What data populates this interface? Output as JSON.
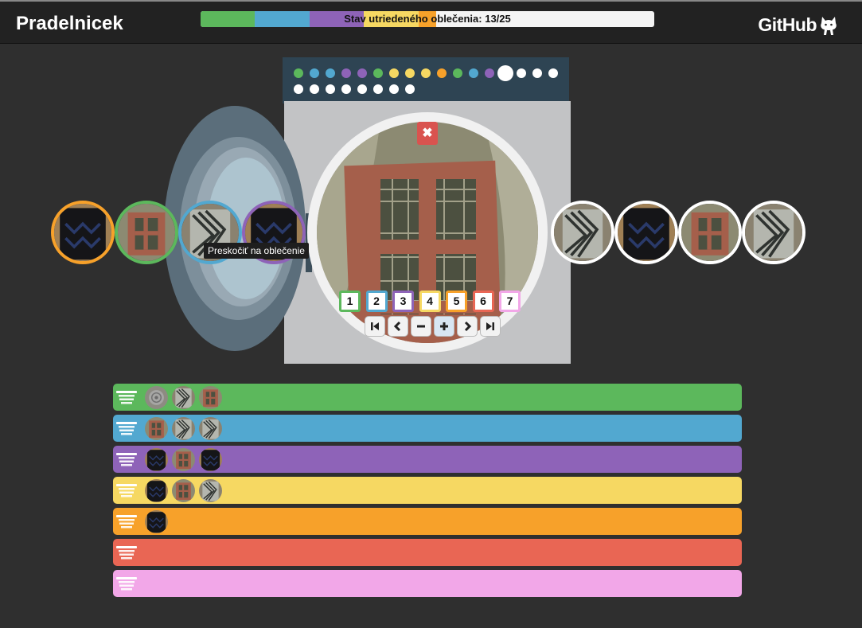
{
  "header": {
    "title": "Pradelnicek",
    "github_label": "GitHub",
    "progress_text": "Stav utriedeného oblečenia: 13/25",
    "progress_segments": [
      {
        "color": "#5cb85c",
        "fraction": 0.12
      },
      {
        "color": "#52a8d0",
        "fraction": 0.12
      },
      {
        "color": "#8e63b8",
        "fraction": 0.12
      },
      {
        "color": "#f6d862",
        "fraction": 0.12
      },
      {
        "color": "#f7a12a",
        "fraction": 0.04
      }
    ]
  },
  "dots": {
    "colors": [
      "#5cb85c",
      "#52a8d0",
      "#52a8d0",
      "#8e63b8",
      "#8e63b8",
      "#5cb85c",
      "#f6d862",
      "#f6d862",
      "#f6d862",
      "#f7a12a",
      "#5cb85c",
      "#52a8d0",
      "#8e63b8",
      "#ffffff",
      "#ffffff",
      "#ffffff",
      "#ffffff",
      "#ffffff",
      "#ffffff",
      "#ffffff",
      "#ffffff",
      "#ffffff",
      "#ffffff",
      "#ffffff",
      "#ffffff"
    ],
    "current_index": 13
  },
  "main": {
    "close_icon": "close-icon",
    "number_buttons": [
      {
        "label": "1",
        "color": "#5cb85c"
      },
      {
        "label": "2",
        "color": "#52a8d0"
      },
      {
        "label": "3",
        "color": "#8e63b8"
      },
      {
        "label": "4",
        "color": "#f6d862"
      },
      {
        "label": "5",
        "color": "#f7a12a"
      },
      {
        "label": "6",
        "color": "#e96654"
      },
      {
        "label": "7",
        "color": "#f2a7e8"
      }
    ],
    "controls": [
      "first-icon",
      "prev-icon",
      "minus-icon",
      "plus-icon",
      "next-icon",
      "last-icon"
    ]
  },
  "carousel": {
    "left": [
      {
        "border": "#f7a12a",
        "item": "dark-sweater"
      },
      {
        "border": "#5cb85c",
        "item": "pillow"
      },
      {
        "border": "#52a8d0",
        "item": "striped-shirt"
      },
      {
        "border": "#8e63b8",
        "item": "dark-sweater"
      }
    ],
    "right": [
      {
        "border": "#ffffff",
        "item": "striped-shirt"
      },
      {
        "border": "#ffffff",
        "item": "dark-sweater"
      },
      {
        "border": "#ffffff",
        "item": "pillow"
      },
      {
        "border": "#ffffff",
        "item": "striped-shirt"
      }
    ],
    "tooltip": "Preskočiť na oblečenie"
  },
  "baskets": [
    {
      "color": "#5cb85c",
      "items": [
        "grey-roll",
        "striped-shirt",
        "pillow"
      ]
    },
    {
      "color": "#52a8d0",
      "items": [
        "pillow",
        "striped-shirt",
        "striped-shirt"
      ]
    },
    {
      "color": "#8e63b8",
      "items": [
        "dark-sweater",
        "pillow",
        "dark-sweater"
      ]
    },
    {
      "color": "#f6d862",
      "items": [
        "dark-sweater",
        "pillow",
        "striped-shirt"
      ]
    },
    {
      "color": "#f7a12a",
      "items": [
        "dark-sweater"
      ]
    },
    {
      "color": "#e96654",
      "items": []
    },
    {
      "color": "#f2a7e8",
      "items": []
    }
  ]
}
